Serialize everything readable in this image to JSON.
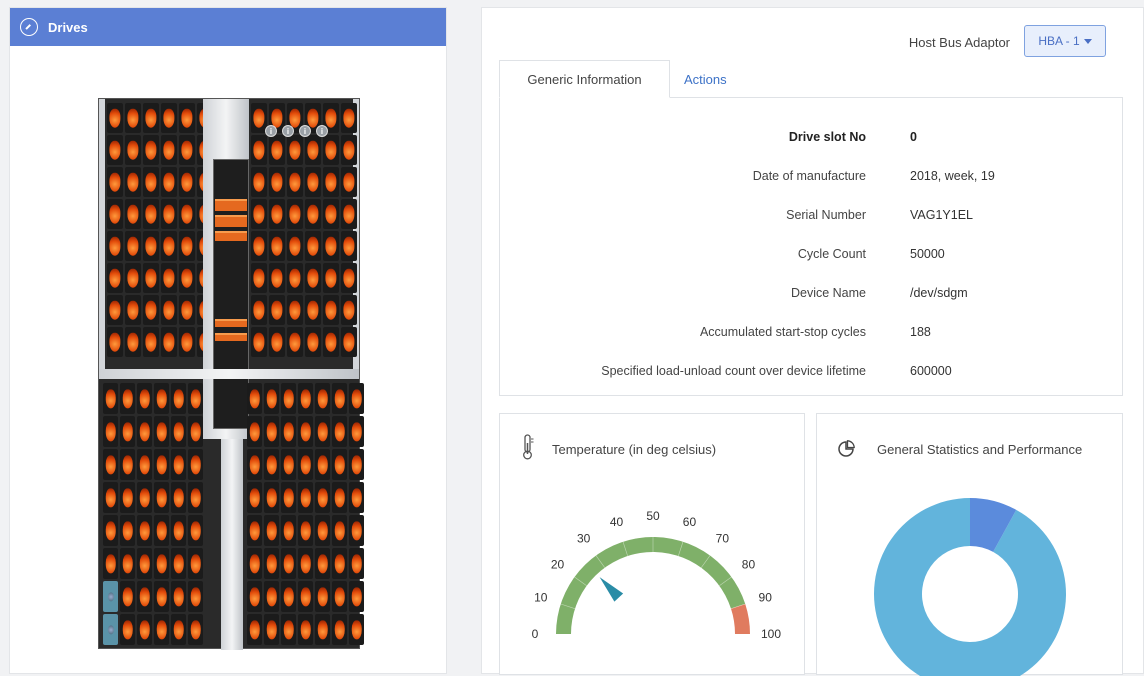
{
  "left_panel": {
    "title": "Drives",
    "icon": "gauge-icon",
    "enclosure_info_badges": [
      "i",
      "i",
      "i",
      "i"
    ]
  },
  "header": {
    "hba_label": "Host Bus Adaptor",
    "hba_selected": "HBA - 1"
  },
  "tabs": [
    {
      "label": "Generic Information",
      "active": true
    },
    {
      "label": "Actions",
      "active": false
    }
  ],
  "drive_info": [
    {
      "key": "Drive slot No",
      "value": "0",
      "bold": true
    },
    {
      "key": "Date of manufacture",
      "value": "2018, week, 19"
    },
    {
      "key": "Serial Number",
      "value": "VAG1Y1EL"
    },
    {
      "key": "Cycle Count",
      "value": "50000"
    },
    {
      "key": "Device Name",
      "value": "/dev/sdgm"
    },
    {
      "key": "Accumulated start-stop cycles",
      "value": "188"
    },
    {
      "key": "Specified load-unload count over device lifetime",
      "value": "600000"
    }
  ],
  "temperature_card": {
    "title": "Temperature (in deg celsius)",
    "icon": "thermometer-icon",
    "gauge": {
      "min": 0,
      "max": 100,
      "ticks": [
        "0",
        "10",
        "20",
        "30",
        "40",
        "50",
        "60",
        "70",
        "80",
        "90",
        "100"
      ],
      "value": 26,
      "normal_color": "#7fb069",
      "danger_color": "#e07b5f",
      "danger_from": 90,
      "pointer_color": "#2a8ca6"
    }
  },
  "stats_card": {
    "title": "General Statistics and Performance",
    "icon": "pie-chart-icon",
    "donut": {
      "segments": [
        {
          "value": 92,
          "color": "#62b4dc"
        },
        {
          "value": 8,
          "color": "#5b8bdc"
        }
      ]
    }
  },
  "colors": {
    "header_blue": "#5b7fd4",
    "link_blue": "#3d72c7",
    "drive_orange": "#e5691f"
  }
}
